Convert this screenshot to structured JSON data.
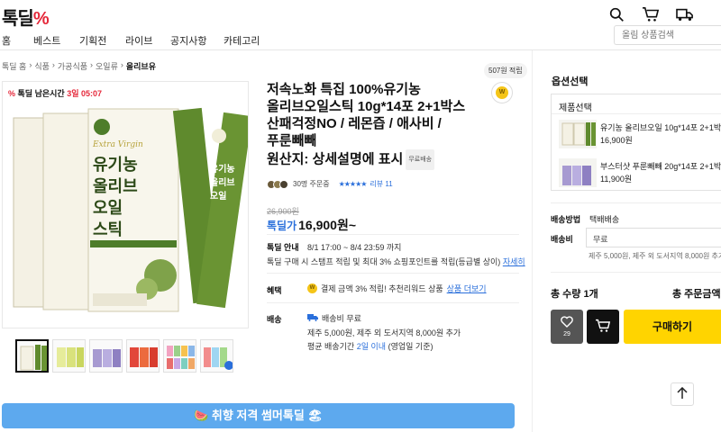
{
  "header": {
    "logo_text": "톡딜",
    "logo_mark": "%"
  },
  "nav": {
    "items": [
      "홈",
      "베스트",
      "기획전",
      "라이브",
      "공지사항",
      "카테고리"
    ]
  },
  "search": {
    "placeholder": "올림 상품검색"
  },
  "breadcrumb": [
    "톡딜 홈",
    "식품",
    "가공식품",
    "오일류",
    "올리브유"
  ],
  "product": {
    "sale_tag_prefix": "톡딜 남은시간",
    "sale_time": "3일 05:07",
    "reward_badge": "507원 적립",
    "coin_label": "W",
    "title_lines": [
      "저속노화 특집 100%유기농",
      "올리브오일스틱 10g*14포 2+1박스",
      "산패걱정NO / 레몬즙 / 애사비 /",
      "푸룬빼빼",
      "원산지: 상세설명에 표시"
    ],
    "free_ship_tag": "무료배송",
    "review_count_text": "30명 주문중",
    "stars": "★★★★★",
    "review_link": "리뷰 11",
    "original_price": "26,900원",
    "price_label": "톡딜가",
    "price": "16,900원~",
    "deal_label": "톡딜 안내",
    "deal_period": "8/1 17:00 ~ 8/4 23:59 까지",
    "deal_desc": "톡딜 구매 시 스탬프 적립 및 최대 3% 쇼핑포인트를 적립(등급별 상이)",
    "deal_link": "자세히",
    "benefit_label": "혜택",
    "benefit_text": "결제 금액 3% 적립! 추천리워드 상품",
    "benefit_link": "상품 더보기",
    "ship_label": "배송",
    "ship_fee": "배송비 무료",
    "ship_extra": "제주 5,000원, 제주 외 도서지역 8,000원 추가",
    "ship_avg_prefix": "평균 배송기간",
    "ship_avg_days": "2일 이내",
    "ship_avg_suffix": "(영업일 기준)",
    "banner_text": "🍉 취향 저격 썸머톡딜 🏖"
  },
  "panel": {
    "title": "옵션선택",
    "option_head": "제품선택",
    "options": [
      {
        "name": "유기농 올리브오일 10g*14포 2+1박스",
        "price": "16,900원"
      },
      {
        "name": "부스터샷 푸룬빼빼 20g*14포 2+1박스",
        "price": "11,900원"
      }
    ],
    "ship_method_label": "배송방법",
    "ship_method_value": "택배배송",
    "ship_fee_label": "배송비",
    "ship_fee_value": "무료",
    "ship_fee_note": "제주 5,000원, 제주 외 도서지역 8,000원 추가",
    "total_qty": "총 수량 1개",
    "total_price": "총 주문금액",
    "like_count": "29",
    "buy_label": "구매하기"
  },
  "colors": {
    "accent_blue": "#2a6fdb",
    "buy_yellow": "#ffd400",
    "sale_red": "#e5283a",
    "banner_blue": "#5da9ee",
    "product_green": "#4e7d2a"
  },
  "icons": [
    "search-icon",
    "cart-icon",
    "truck-icon",
    "heart-icon",
    "cart-button-icon",
    "arrow-up-icon",
    "truck-small-icon",
    "coin-icon"
  ]
}
